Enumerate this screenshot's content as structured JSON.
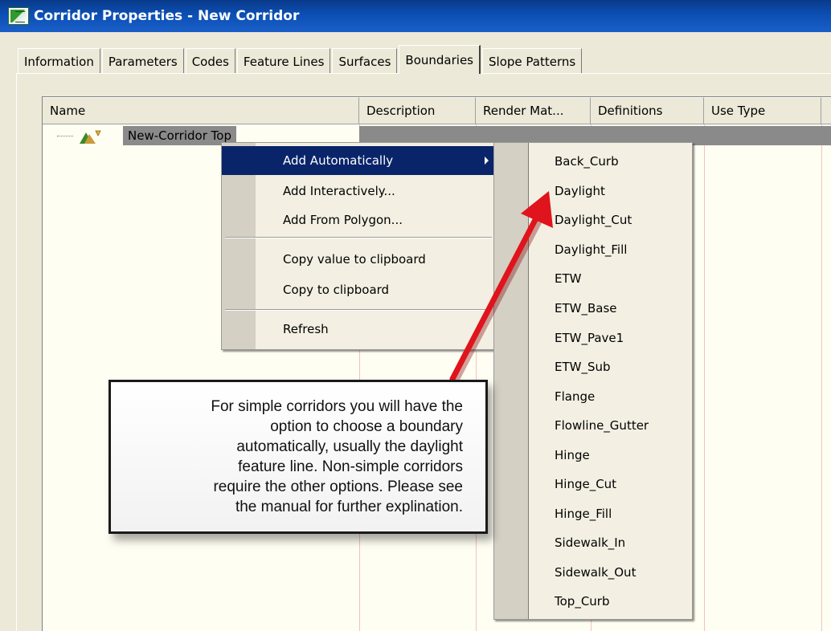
{
  "window": {
    "title": "Corridor Properties - New Corridor"
  },
  "tabs": [
    "Information",
    "Parameters",
    "Codes",
    "Feature Lines",
    "Surfaces",
    "Boundaries",
    "Slope Patterns"
  ],
  "active_tab": "Boundaries",
  "columns": [
    "Name",
    "Description",
    "Render Mat...",
    "Definitions",
    "Use Type"
  ],
  "tree": {
    "row_label": "New-Corridor Top"
  },
  "context_menu": {
    "items": [
      "Add Automatically",
      "Add Interactively...",
      "Add From Polygon...",
      "Copy value to clipboard",
      "Copy to clipboard",
      "Refresh"
    ],
    "highlighted": "Add Automatically"
  },
  "submenu": {
    "items": [
      "Back_Curb",
      "Daylight",
      "Daylight_Cut",
      "Daylight_Fill",
      "ETW",
      "ETW_Base",
      "ETW_Pave1",
      "ETW_Sub",
      "Flange",
      "Flowline_Gutter",
      "Hinge",
      "Hinge_Cut",
      "Hinge_Fill",
      "Sidewalk_In",
      "Sidewalk_Out",
      "Top_Curb"
    ]
  },
  "callout": {
    "lines": [
      "For simple corridors you will have the",
      "option to choose a boundary",
      "automatically, usually the daylight",
      "feature line.  Non-simple corridors",
      "require the other options.  Please see",
      "the manual for further explination."
    ]
  },
  "colors": {
    "title_bar": "#0b4fb4",
    "menu_highlight": "#0a246a",
    "list_background": "#fffef3",
    "arrow": "#e0141c"
  }
}
